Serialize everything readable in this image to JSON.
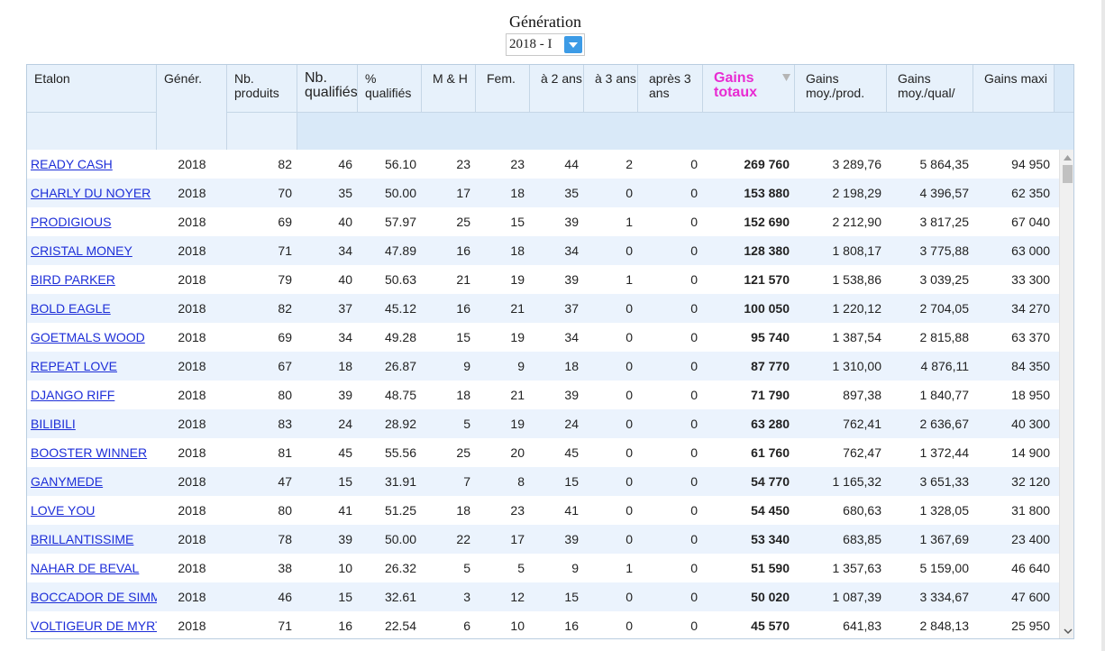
{
  "generation": {
    "title": "Génération",
    "selected": "2018 - I"
  },
  "filters": {
    "etalon_value": "",
    "produits_value": ""
  },
  "headers": {
    "etalon": "Etalon",
    "gener": "Génér.",
    "nb_produits": "Nb. produits",
    "nb_qualifies": "Nb. qualifiés",
    "pct_qualifies": "% qualifiés",
    "mh": "M & H",
    "fem": "Fem.",
    "a2ans": "à 2 ans",
    "a3ans": "à 3 ans",
    "apres3ans": "après 3 ans",
    "gains_totaux": "Gains totaux",
    "gains_moy_prod": "Gains moy./prod.",
    "gains_moy_qual": "Gains moy./qual/",
    "gains_maxi": "Gains maxi"
  },
  "rows": [
    [
      "READY CASH",
      "2018",
      "82",
      "46",
      "56.10",
      "23",
      "23",
      "44",
      "2",
      "0",
      "269 760",
      "3 289,76",
      "5 864,35",
      "94 950"
    ],
    [
      "CHARLY DU NOYER",
      "2018",
      "70",
      "35",
      "50.00",
      "17",
      "18",
      "35",
      "0",
      "0",
      "153 880",
      "2 198,29",
      "4 396,57",
      "62 350"
    ],
    [
      "PRODIGIOUS",
      "2018",
      "69",
      "40",
      "57.97",
      "25",
      "15",
      "39",
      "1",
      "0",
      "152 690",
      "2 212,90",
      "3 817,25",
      "67 040"
    ],
    [
      "CRISTAL MONEY",
      "2018",
      "71",
      "34",
      "47.89",
      "16",
      "18",
      "34",
      "0",
      "0",
      "128 380",
      "1 808,17",
      "3 775,88",
      "63 000"
    ],
    [
      "BIRD PARKER",
      "2018",
      "79",
      "40",
      "50.63",
      "21",
      "19",
      "39",
      "1",
      "0",
      "121 570",
      "1 538,86",
      "3 039,25",
      "33 300"
    ],
    [
      "BOLD EAGLE",
      "2018",
      "82",
      "37",
      "45.12",
      "16",
      "21",
      "37",
      "0",
      "0",
      "100 050",
      "1 220,12",
      "2 704,05",
      "34 270"
    ],
    [
      "GOETMALS WOOD",
      "2018",
      "69",
      "34",
      "49.28",
      "15",
      "19",
      "34",
      "0",
      "0",
      "95 740",
      "1 387,54",
      "2 815,88",
      "63 370"
    ],
    [
      "REPEAT LOVE",
      "2018",
      "67",
      "18",
      "26.87",
      "9",
      "9",
      "18",
      "0",
      "0",
      "87 770",
      "1 310,00",
      "4 876,11",
      "84 350"
    ],
    [
      "DJANGO RIFF",
      "2018",
      "80",
      "39",
      "48.75",
      "18",
      "21",
      "39",
      "0",
      "0",
      "71 790",
      "897,38",
      "1 840,77",
      "18 950"
    ],
    [
      "BILIBILI",
      "2018",
      "83",
      "24",
      "28.92",
      "5",
      "19",
      "24",
      "0",
      "0",
      "63 280",
      "762,41",
      "2 636,67",
      "40 300"
    ],
    [
      "BOOSTER WINNER",
      "2018",
      "81",
      "45",
      "55.56",
      "25",
      "20",
      "45",
      "0",
      "0",
      "61 760",
      "762,47",
      "1 372,44",
      "14 900"
    ],
    [
      "GANYMEDE",
      "2018",
      "47",
      "15",
      "31.91",
      "7",
      "8",
      "15",
      "0",
      "0",
      "54 770",
      "1 165,32",
      "3 651,33",
      "32 120"
    ],
    [
      "LOVE YOU",
      "2018",
      "80",
      "41",
      "51.25",
      "18",
      "23",
      "41",
      "0",
      "0",
      "54 450",
      "680,63",
      "1 328,05",
      "31 800"
    ],
    [
      "BRILLANTISSIME",
      "2018",
      "78",
      "39",
      "50.00",
      "22",
      "17",
      "39",
      "0",
      "0",
      "53 340",
      "683,85",
      "1 367,69",
      "23 400"
    ],
    [
      "NAHAR DE BEVAL",
      "2018",
      "38",
      "10",
      "26.32",
      "5",
      "5",
      "9",
      "1",
      "0",
      "51 590",
      "1 357,63",
      "5 159,00",
      "46 640"
    ],
    [
      "BOCCADOR DE SIMM",
      "2018",
      "46",
      "15",
      "32.61",
      "3",
      "12",
      "15",
      "0",
      "0",
      "50 020",
      "1 087,39",
      "3 334,67",
      "47 600"
    ],
    [
      "VOLTIGEUR DE MYRT",
      "2018",
      "71",
      "16",
      "22.54",
      "6",
      "10",
      "16",
      "0",
      "0",
      "45 570",
      "641,83",
      "2 848,13",
      "25 950"
    ]
  ],
  "colors": {
    "header_bg": "#e7f1fb",
    "alt_row": "#ebf3fd",
    "link": "#1d2ed8",
    "gains_header": "#e82bd2",
    "dropdown_accent": "#3c9be6"
  },
  "icons": {
    "dropdown": "chevron-down-icon",
    "sort": "sort-desc-icon",
    "scroll_up": "scroll-up-icon",
    "scroll_down": "scroll-down-icon"
  }
}
